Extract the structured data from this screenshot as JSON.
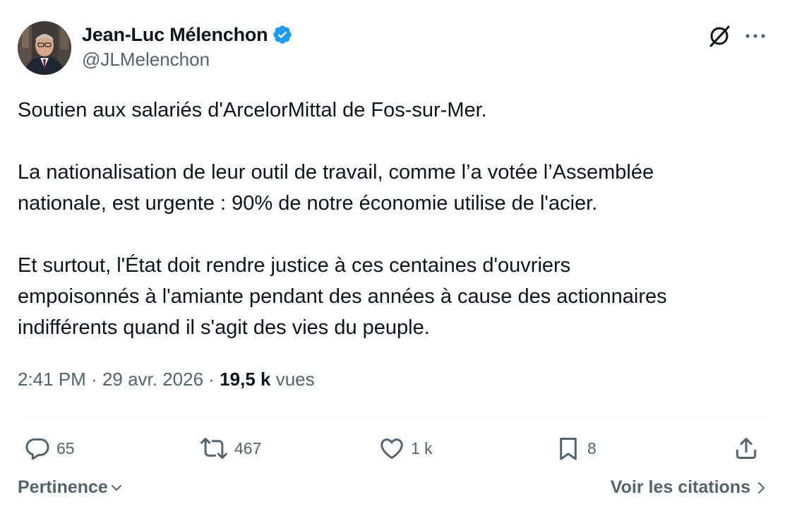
{
  "author": {
    "name": "Jean-Luc Mélenchon",
    "handle": "@JLMelenchon",
    "verified": true,
    "verified_color": "#1d9bf0"
  },
  "tweet": {
    "paragraphs": [
      "Soutien aux salariés d'ArcelorMittal de Fos-sur-Mer.",
      "La nationalisation de leur outil de travail, comme l’a votée l’Assemblée\nnationale, est urgente : 90% de notre économie utilise de l'acier.",
      "Et surtout, l'État doit rendre justice à ces centaines d'ouvriers\nempoisonnés à l'amiante pendant des années à cause des actionnaires\nindifférents quand il s'agit des vies du peuple."
    ]
  },
  "meta": {
    "time": "2:41 PM",
    "separator": " · ",
    "date": "29 avr. 2026",
    "views_count": "19,5 k",
    "views_label": "vues"
  },
  "actions": {
    "replies": "65",
    "reposts": "467",
    "likes": "1 k",
    "bookmarks": "8"
  },
  "footer": {
    "sort_label": "Pertinence",
    "quotes_label": "Voir les citations"
  },
  "icons": {
    "grok": "grok-icon",
    "more": "more-icon",
    "reply": "reply-icon",
    "repost": "repost-icon",
    "like": "like-icon",
    "bookmark": "bookmark-icon",
    "share": "share-icon",
    "chevron_down": "chevron-down-icon",
    "chevron_right": "chevron-right-icon"
  },
  "colors": {
    "text": "#0f1419",
    "secondary": "#536471",
    "accent": "#1d9bf0",
    "divider": "#eff3f4"
  }
}
